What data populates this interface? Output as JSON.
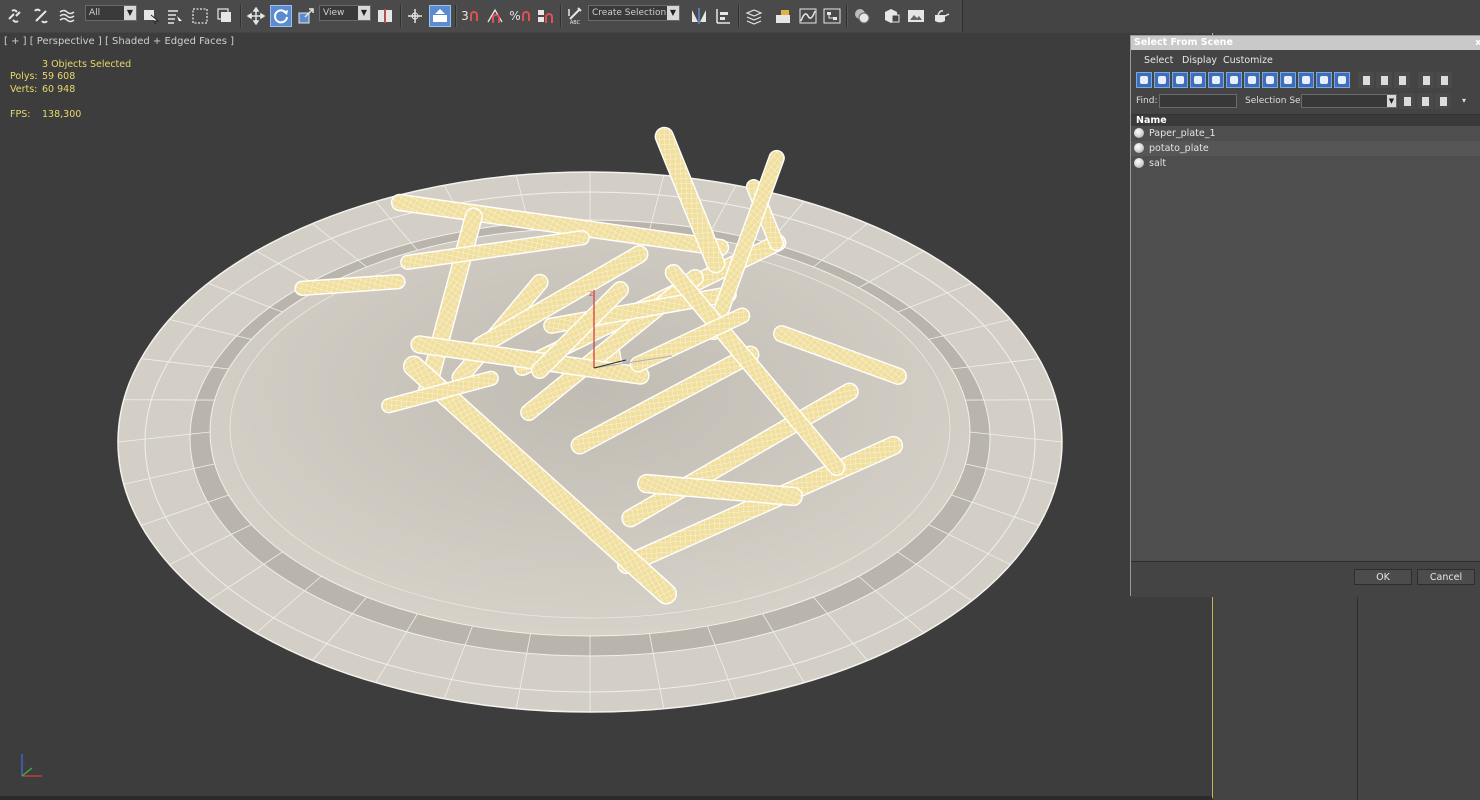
{
  "toolbar": {
    "selection_filter": "All",
    "reference_coord": "View",
    "named_selection_placeholder": "Create Selection Se",
    "snap_angle_label": "3",
    "snap_percent_label": "%",
    "edit_named_label": "ABC"
  },
  "viewport": {
    "label": "[ + ] [ Perspective ] [ Shaded + Edged Faces ]",
    "selection_status": "3 Objects Selected",
    "polys_label": "Polys:",
    "polys_value": "59 608",
    "verts_label": "Verts:",
    "verts_value": "60 948",
    "fps_label": "FPS:",
    "fps_value": "138,300",
    "gizmo_z": "z"
  },
  "dialog": {
    "title": "Select From Scene",
    "close": "x",
    "menu": [
      "Select",
      "Display",
      "Customize"
    ],
    "find_label": "Find:",
    "selection_set_label": "Selection Set:",
    "column_name": "Name",
    "objects": [
      {
        "name": "Paper_plate_1"
      },
      {
        "name": "potato_plate"
      },
      {
        "name": "salt"
      }
    ],
    "ok_label": "OK",
    "cancel_label": "Cancel"
  },
  "colors": {
    "accent_blue": "#5b8bd0",
    "stats_yellow": "#e8d86a",
    "plate": "#cfcac0",
    "fries": "#f1df9e"
  }
}
